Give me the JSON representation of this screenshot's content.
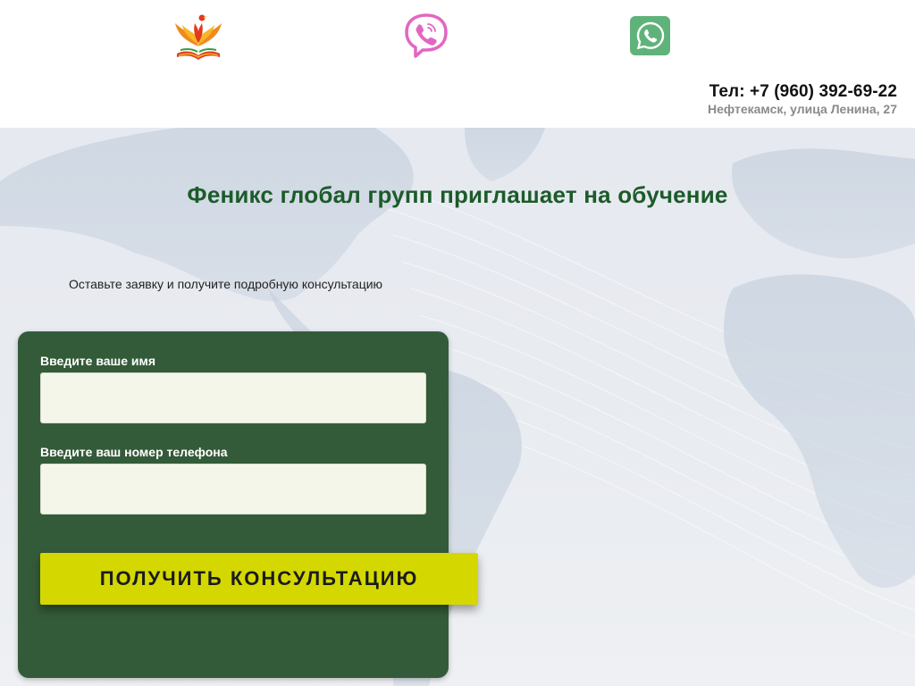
{
  "header": {
    "logo_icon": "phoenix-book-logo",
    "viber_icon": "viber-icon",
    "whatsapp_icon": "whatsapp-icon",
    "phone": "Тел: +7 (960) 392-69-22",
    "address": "Нефтекамск, улица Ленина, 27"
  },
  "hero": {
    "headline": "Феникс глобал групп приглашает на обучение",
    "subtext": "Оставьте заявку и получите подробную консультацию"
  },
  "form": {
    "name_label": "Введите ваше имя",
    "name_value": "",
    "phone_label": "Введите ваш номер телефона",
    "phone_value": "",
    "submit_label": "ПОЛУЧИТЬ КОНСУЛЬТАЦИЮ"
  },
  "colors": {
    "headline": "#1c5b2a",
    "form_bg": "#345b39",
    "button_bg": "#d4d800",
    "input_bg": "#f4f6ea"
  }
}
